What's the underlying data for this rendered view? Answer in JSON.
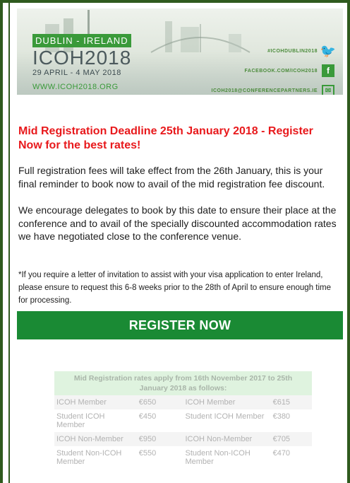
{
  "banner": {
    "city_tag": "DUBLIN - IRELAND",
    "title": "ICOH2018",
    "dates": "29 APRIL - 4 MAY 2018",
    "website": "WWW.ICOH2018.ORG",
    "socials": [
      {
        "text": "#ICOHDUBLIN2018",
        "icon": "twitter-icon"
      },
      {
        "text": "FACEBOOK.COM/ICOH2018",
        "icon": "facebook-icon"
      },
      {
        "text": "ICOH2018@CONFERENCEPARTNERS.IE",
        "icon": "mail-icon"
      }
    ],
    "colors": {
      "brand_green": "#3a9a3a",
      "frame": "#2f5a1e"
    }
  },
  "headline": "Mid Registration Deadline 25th January 2018 - Register Now for the best rates!",
  "paragraph1": "Full registration fees will take effect from the 26th January, this is your final reminder to book now to avail of the mid registration fee discount.",
  "paragraph2": "We encourage delegates to book by this date to ensure their place at the conference and to avail of the specially discounted accommodation rates we have negotiated close to the conference venue.",
  "paragraph3": "*If you require a letter of invitation to assist with your visa application to enter Ireland, please ensure to request this 6-8 weeks prior to the 28th of April to ensure enough time for processing.",
  "register_button": "REGISTER NOW",
  "rates": {
    "header": "Mid Registration rates apply from 16th November 2017 to 25th January 2018 as follows:",
    "rows": [
      [
        "ICOH Member",
        "€650",
        "ICOH Member",
        "€615"
      ],
      [
        "Student ICOH Member",
        "€450",
        "Student ICOH Member",
        "€380"
      ],
      [
        "ICOH Non-Member",
        "€950",
        "ICOH Non-Member",
        "€705"
      ],
      [
        "Student Non-ICOH Member",
        "€550",
        "Student Non-ICOH Member",
        "€470"
      ]
    ]
  }
}
